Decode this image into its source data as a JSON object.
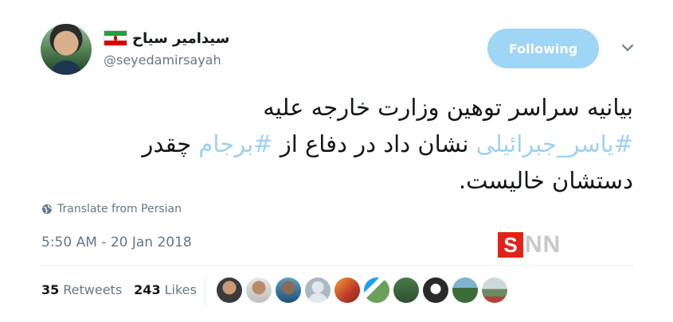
{
  "author": {
    "display_name": "سیدامیر سیاح",
    "handle": "@seyedamirsayah",
    "flag": "iran-flag"
  },
  "follow_button": {
    "label": "Following"
  },
  "tweet": {
    "line1": "بیانیه سراسر توهین وزارت خارجه علیه",
    "hashtag1": "#یاسر_جبرائیلی",
    "mid": " نشان داد در دفاع از ",
    "hashtag2": "#برجام",
    "after2": " چقدر",
    "line3": "دستشان خالیست."
  },
  "translate_label": "Translate from Persian",
  "timestamp": "5:50 AM - 20 Jan 2018",
  "watermark": {
    "s": "S",
    "rest": "NN"
  },
  "stats": {
    "retweets_count": "35",
    "retweets_label": "Retweets",
    "likes_count": "243",
    "likes_label": "Likes"
  },
  "colors": {
    "hashtag": "#9cd1f2",
    "follow_bg": "#9fd5f5",
    "muted": "#657786"
  },
  "likers": [
    "avatar-1",
    "avatar-2",
    "avatar-3",
    "avatar-4",
    "avatar-5",
    "avatar-6",
    "avatar-7",
    "avatar-8",
    "avatar-9",
    "avatar-10"
  ]
}
